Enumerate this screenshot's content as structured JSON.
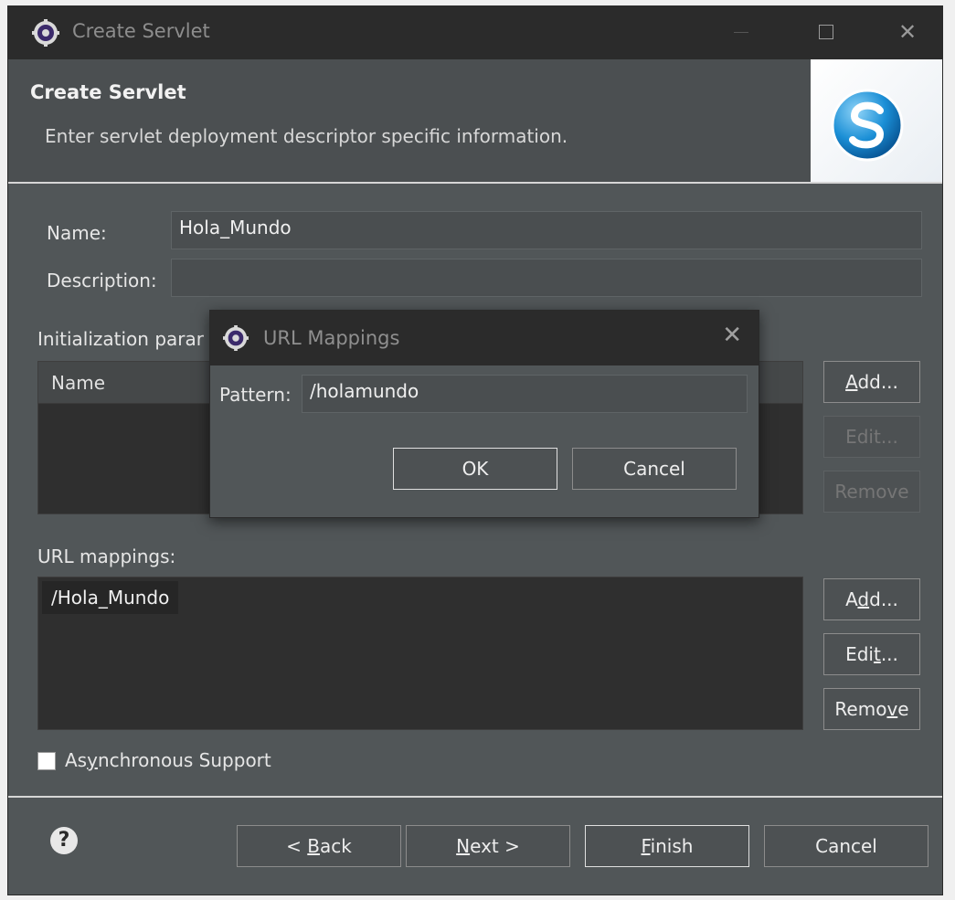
{
  "window": {
    "title": "Create Servlet"
  },
  "header": {
    "title": "Create Servlet",
    "description": "Enter servlet deployment descriptor specific information."
  },
  "form": {
    "name_label": "Name:",
    "name_value": "Hola_Mundo",
    "description_label": "Description:",
    "description_value": ""
  },
  "init_params": {
    "label": "Initialization parar",
    "column_name": "Name",
    "add_label_pre": "",
    "add_label_key": "A",
    "add_label_post": "dd...",
    "edit_label": "Edit...",
    "remove_label": "Remove"
  },
  "url_mappings": {
    "label": "URL mappings:",
    "items": [
      "/Hola_Mundo"
    ],
    "add_label_pre": "A",
    "add_label_key": "d",
    "add_label_post": "d...",
    "edit_label_pre": "Edi",
    "edit_label_key": "t",
    "edit_label_post": "...",
    "remove_label_pre": "Remo",
    "remove_label_key": "v",
    "remove_label_post": "e"
  },
  "async": {
    "label_pre": "As",
    "label_key": "y",
    "label_post": "nchronous Support",
    "checked": false
  },
  "footer": {
    "back_pre": "< ",
    "back_key": "B",
    "back_post": "ack",
    "next_pre": "",
    "next_key": "N",
    "next_post": "ext >",
    "finish_pre": "",
    "finish_key": "F",
    "finish_post": "inish",
    "cancel_label": "Cancel"
  },
  "dialog": {
    "title": "URL Mappings",
    "pattern_label": "Pattern:",
    "pattern_value": "/holamundo",
    "ok_label": "OK",
    "cancel_label": "Cancel"
  }
}
